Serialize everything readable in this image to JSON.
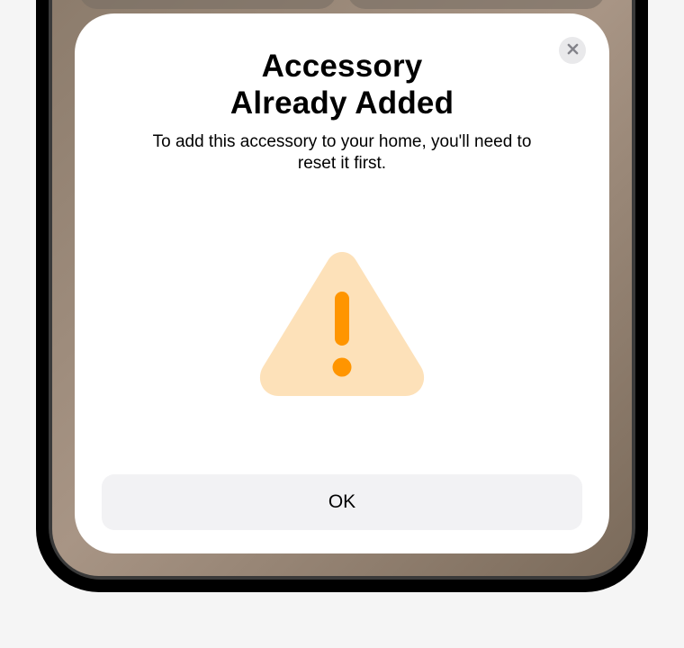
{
  "modal": {
    "title": "Accessory\nAlready Added",
    "subtitle": "To add this accessory to your home, you'll need to reset it first.",
    "ok_label": "OK",
    "close_icon_name": "close-icon",
    "warning_icon_name": "warning-triangle-icon"
  },
  "colors": {
    "warning_fill": "#fde1b9",
    "warning_mark": "#ff9500",
    "close_bg": "#e9e9eb",
    "close_x": "#83838a",
    "ok_bg": "#f2f2f4"
  }
}
